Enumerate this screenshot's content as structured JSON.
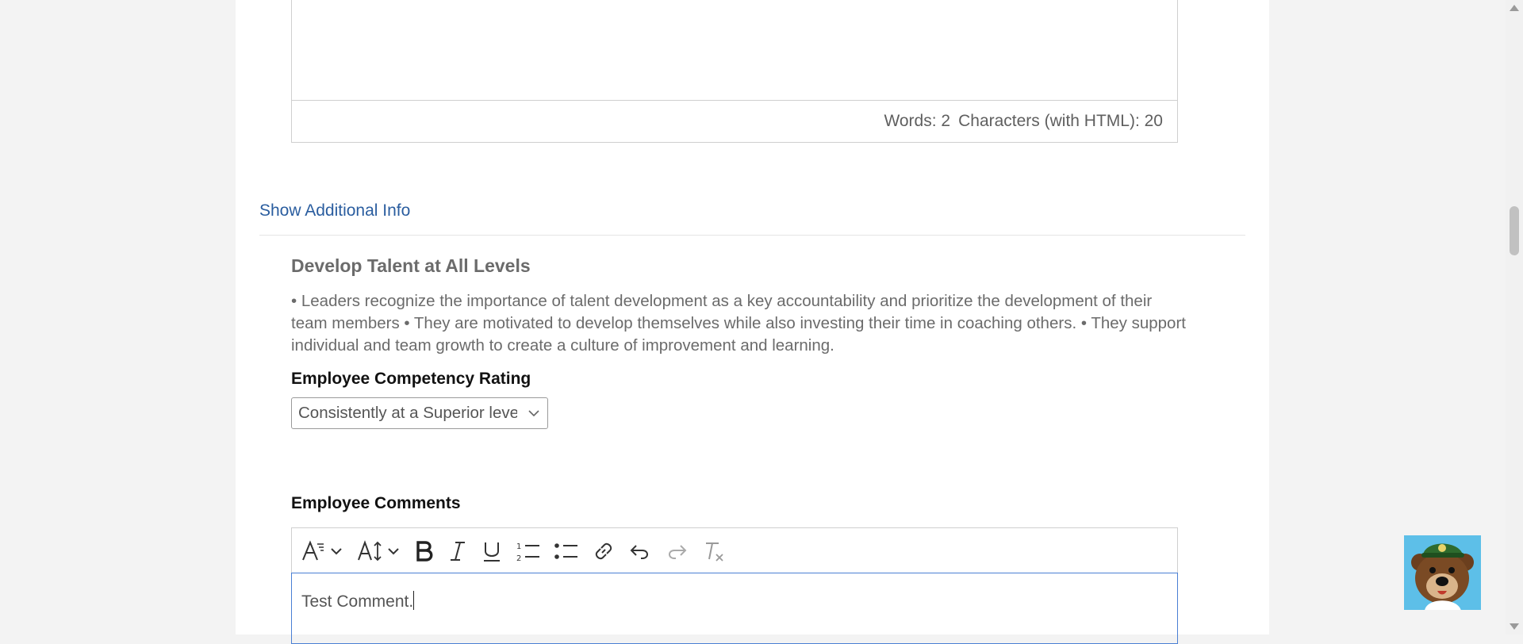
{
  "editor_top": {
    "words": "Words: 2",
    "characters": "Characters (with HTML): 20"
  },
  "show_additional_info": "Show Additional Info",
  "competency": {
    "title": "Develop Talent at All Levels",
    "description": "• Leaders recognize the importance of talent development as a key accountability and prioritize the development of their team members • They are motivated to develop themselves while also investing their time in coaching others. • They support individual and team growth to create a culture of improvement and learning."
  },
  "rating": {
    "label": "Employee Competency Rating",
    "selected": "Consistently at a Superior level"
  },
  "comments": {
    "label": "Employee Comments",
    "value": "Test Comment."
  },
  "toolbar": {
    "icons": [
      "font-style-icon",
      "font-size-icon",
      "bold-icon",
      "italic-icon",
      "underline-icon",
      "ordered-list-icon",
      "bullet-list-icon",
      "link-icon",
      "undo-icon",
      "redo-icon",
      "clear-format-icon"
    ]
  },
  "colors": {
    "link": "#2a5d9f",
    "focus_border": "#4a7fd4",
    "mascot_bg": "#5dbfe8"
  }
}
